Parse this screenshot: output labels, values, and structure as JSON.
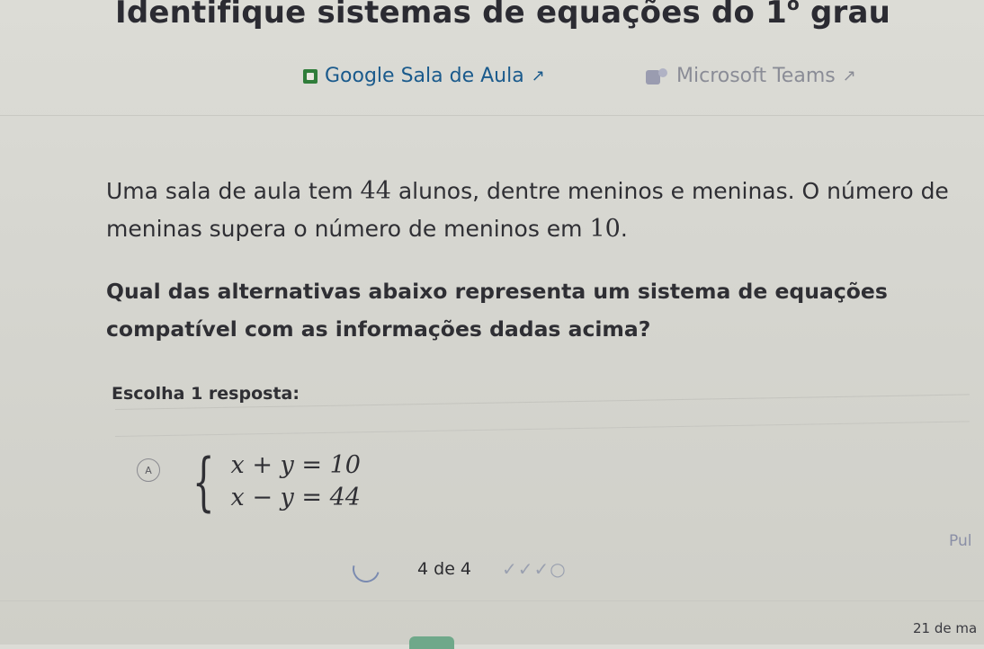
{
  "page": {
    "title_main": "Identifique sistemas de equações do ",
    "title_sup_base": "1",
    "title_sup": "o",
    "title_end": " grau"
  },
  "links": {
    "google": "Google Sala de Aula",
    "teams": "Microsoft Teams",
    "external_glyph": "↗"
  },
  "question": {
    "p1_a": "Uma sala de aula tem ",
    "p1_num1": "44",
    "p1_b": " alunos, dentre meninos e meninas. O número de",
    "p1_c": "meninas supera o número de meninos em ",
    "p1_num2": "10",
    "p1_end": ".",
    "p2": "Qual das alternativas abaixo representa um sistema de equações compatível com as informações dadas acima?"
  },
  "answer_prompt": "Escolha 1 resposta:",
  "options": [
    {
      "letter": "A",
      "eq1": "x + y = 10",
      "eq2": "x − y = 44"
    }
  ],
  "side_label": "Pul",
  "progress": {
    "text": "4 de 4",
    "checks": "✓✓✓○"
  },
  "footer_date": "21 de ma",
  "colors": {
    "link": "#1a5a8c",
    "teams": "#8a8c96",
    "classroom_green": "#2f7d3a"
  }
}
